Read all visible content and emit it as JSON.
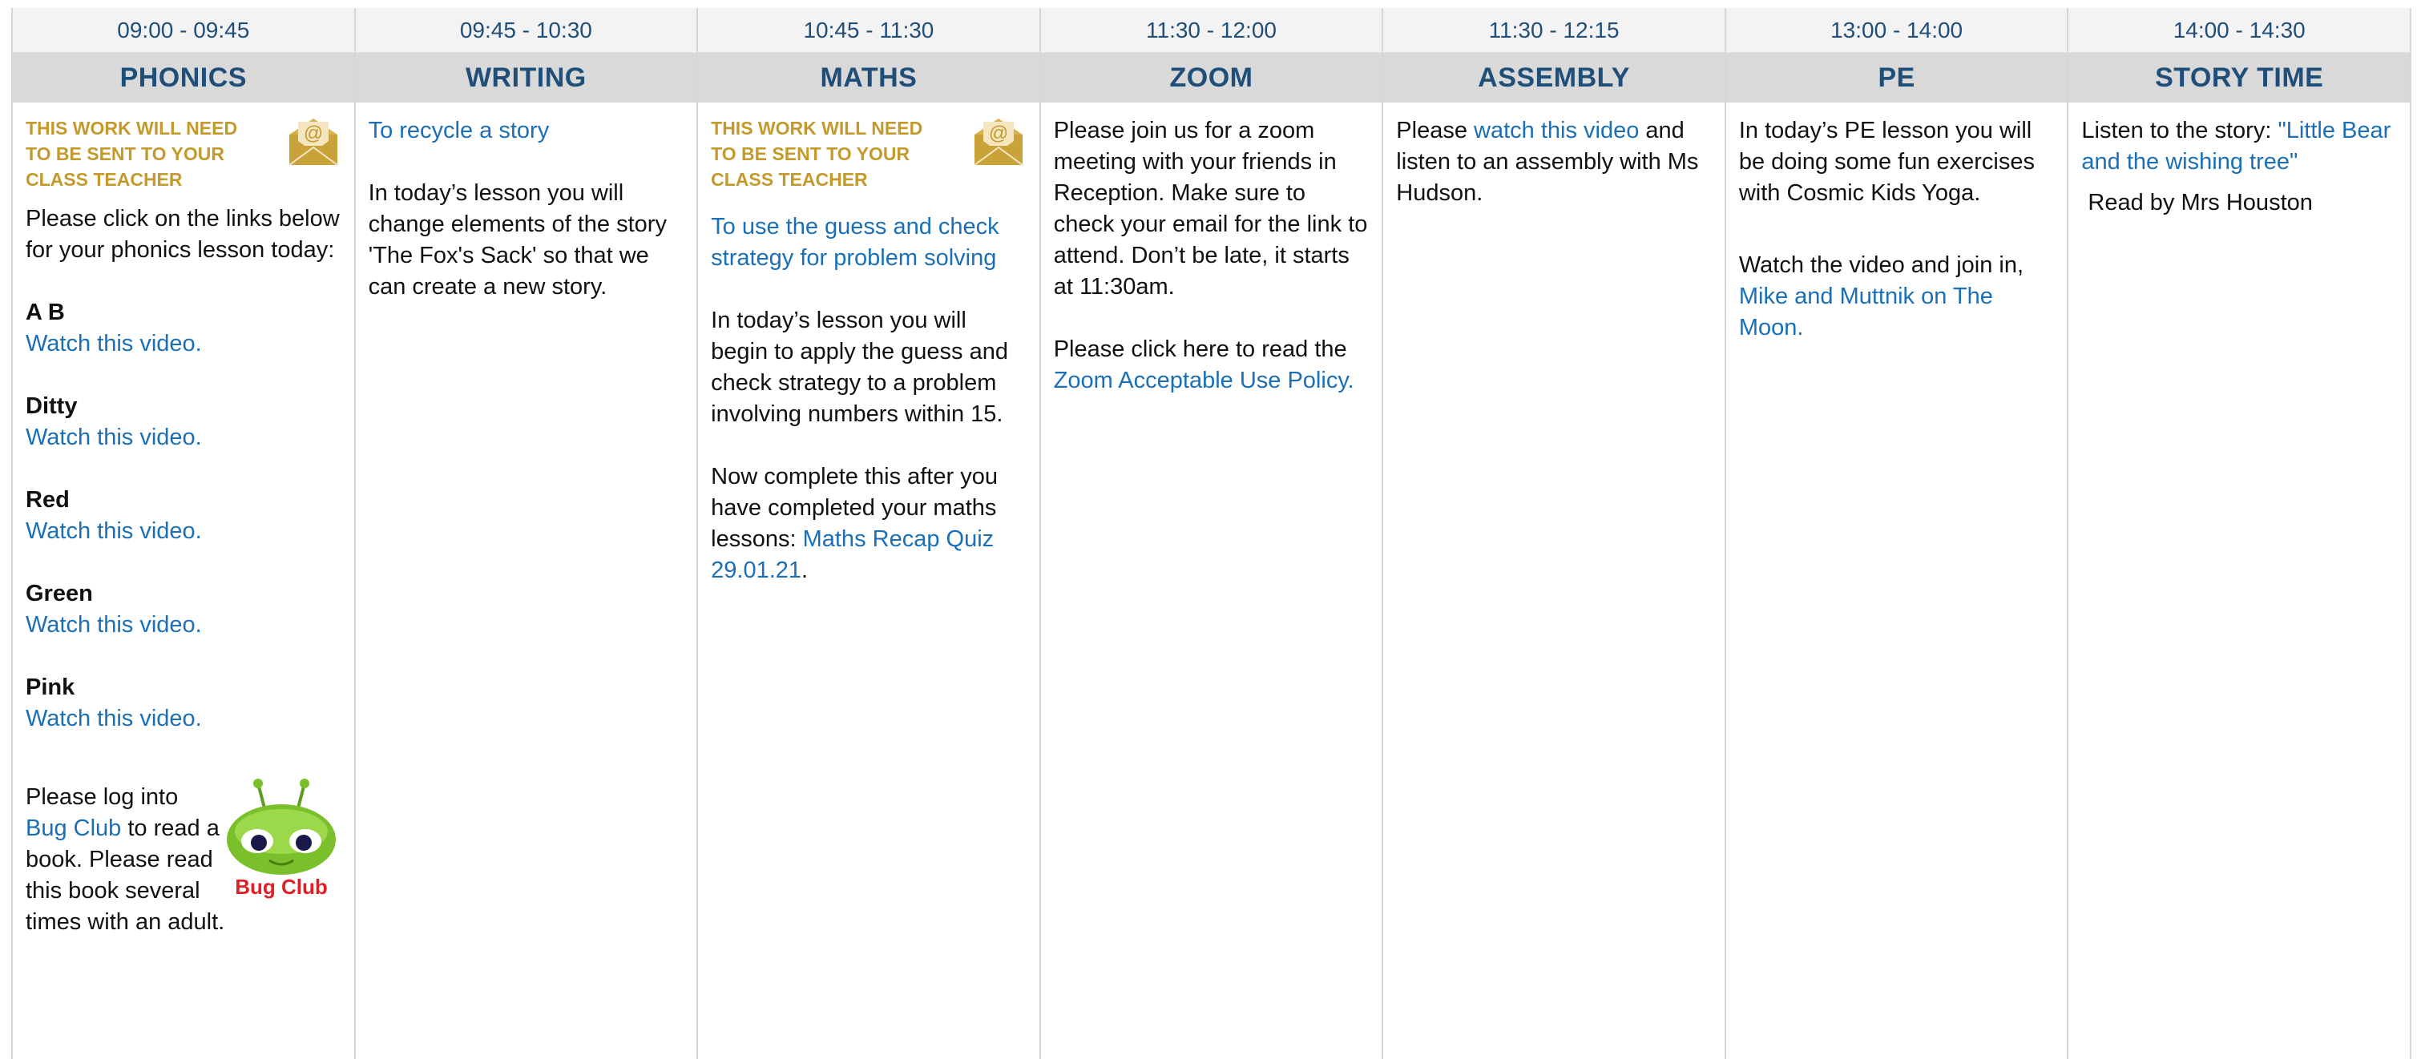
{
  "columns": [
    {
      "time": "09:00 - 09:45",
      "subject": "PHONICS"
    },
    {
      "time": "09:45 - 10:30",
      "subject": "WRITING"
    },
    {
      "time": "10:45 - 11:30",
      "subject": "MATHS"
    },
    {
      "time": "11:30 - 12:00",
      "subject": "ZOOM"
    },
    {
      "time": "11:30 - 12:15",
      "subject": "ASSEMBLY"
    },
    {
      "time": "13:00 - 14:00",
      "subject": "PE"
    },
    {
      "time": "14:00 - 14:30",
      "subject": "STORY TIME"
    }
  ],
  "notice_text": "THIS WORK WILL NEED TO BE SENT TO YOUR CLASS TEACHER",
  "phonics": {
    "intro": "Please click on the links below for your phonics lesson today:",
    "items": [
      {
        "name": "A B",
        "link": "Watch this video."
      },
      {
        "name": "Ditty",
        "link": "Watch this video."
      },
      {
        "name": "Red",
        "link": "Watch this video."
      },
      {
        "name": "Green",
        "link": "Watch this video."
      },
      {
        "name": "Pink",
        "link": "Watch this video."
      }
    ],
    "bug_pre": "Please log into",
    "bug_link": "Bug Club",
    "bug_post": " to read a book. Please read this book several times with an adult.",
    "bug_logo_text": "Bug Club"
  },
  "writing": {
    "link": "To recycle a story",
    "text": "In today’s lesson you will change elements of the story 'The Fox's Sack' so that we can create a new story."
  },
  "maths": {
    "link": "To use the guess and check strategy for problem solving",
    "text": "In today’s lesson you will begin to apply the guess and check strategy to a problem involving numbers within 15.",
    "quiz_pre": "Now complete this after you have completed your maths lessons: ",
    "quiz_link": "Maths Recap Quiz 29.01.21",
    "quiz_post": "."
  },
  "zoom": {
    "text": "Please join us for a zoom meeting with your friends in Reception. Make sure to check your email for the link to attend. Don’t be late, it starts at 11:30am.",
    "policy_pre": "Please click here to read the ",
    "policy_link": "Zoom Acceptable Use Policy."
  },
  "assembly": {
    "pre": "Please ",
    "link": "watch this video",
    "post": " and listen to an assembly with Ms Hudson."
  },
  "pe": {
    "text": "In today’s PE lesson you will be doing some fun exercises with Cosmic Kids Yoga.",
    "video_pre": "Watch the video and join in, ",
    "video_link": "Mike and Muttnik on The Moon."
  },
  "story": {
    "pre": "Listen to the story: ",
    "link": "\"Little Bear and the wishing tree\"",
    "reader": "Read by Mrs Houston"
  },
  "colors": {
    "header_text": "#1f4e79",
    "link": "#1a6fb6",
    "notice": "#c49a2c",
    "subject_bg": "#d9d9d9",
    "time_bg": "#f3f3f3"
  }
}
